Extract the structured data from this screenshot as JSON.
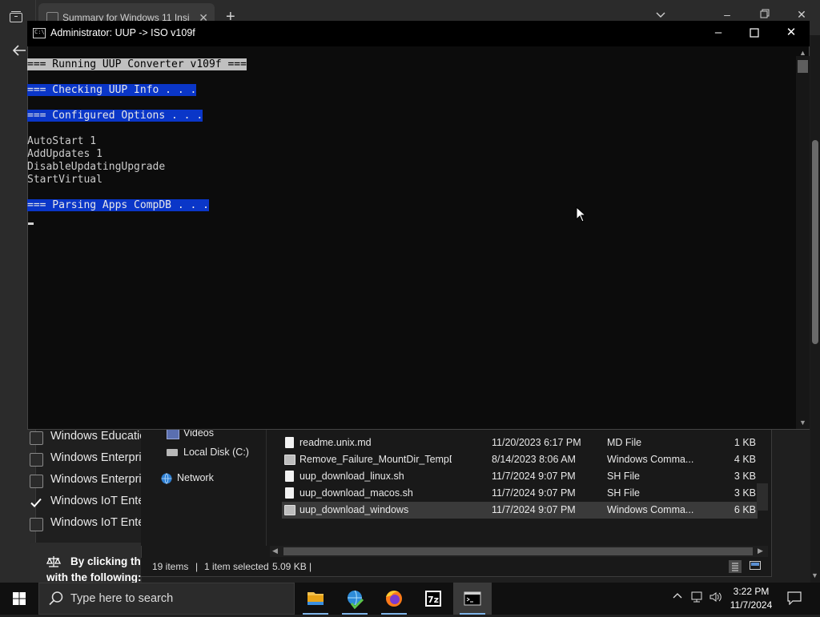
{
  "browser": {
    "tab_title": "Summary for Windows 11 Insi",
    "tab_close": "✕",
    "new_tab": "+",
    "checkbox_items": [
      {
        "label": "Windows Educatio",
        "checked": false
      },
      {
        "label": "Windows Enterpri",
        "checked": false
      },
      {
        "label": "Windows Enterpri",
        "checked": false
      },
      {
        "label": "Windows IoT Ente",
        "checked": true
      },
      {
        "label": "Windows IoT Ente",
        "checked": false
      }
    ],
    "license_line1": "By clicking th",
    "license_line2": "with the following:"
  },
  "console": {
    "title": "Administrator:  UUP -> ISO v109f",
    "lines": [
      {
        "text": "=== Running UUP Converter v109f ===",
        "style": "grey"
      },
      {
        "text": "=== Checking UUP Info . . .",
        "style": "blue"
      },
      {
        "text": "=== Configured Options . . .",
        "style": "blue"
      },
      {
        "text": "AutoStart 1",
        "style": "plain"
      },
      {
        "text": "AddUpdates 1",
        "style": "plain"
      },
      {
        "text": "DisableUpdatingUpgrade",
        "style": "plain"
      },
      {
        "text": "StartVirtual",
        "style": "plain"
      },
      {
        "text": "=== Parsing Apps CompDB . . .",
        "style": "blue"
      }
    ]
  },
  "explorer": {
    "nav": {
      "videos": "Videos",
      "local_disk": "Local Disk (C:)",
      "network": "Network"
    },
    "files": [
      {
        "name": "readme.unix.md",
        "date": "11/20/2023 6:17 PM",
        "type": "MD File",
        "size": "1 KB",
        "icon": "file-icon",
        "selected": false
      },
      {
        "name": "Remove_Failure_MountDir_TempDir",
        "date": "8/14/2023 8:06 AM",
        "type": "Windows Comma...",
        "size": "4 KB",
        "icon": "cmd-icon",
        "selected": false
      },
      {
        "name": "uup_download_linux.sh",
        "date": "11/7/2024 9:07 PM",
        "type": "SH File",
        "size": "3 KB",
        "icon": "file-icon",
        "selected": false
      },
      {
        "name": "uup_download_macos.sh",
        "date": "11/7/2024 9:07 PM",
        "type": "SH File",
        "size": "3 KB",
        "icon": "file-icon",
        "selected": false
      },
      {
        "name": "uup_download_windows",
        "date": "11/7/2024 9:07 PM",
        "type": "Windows Comma...",
        "size": "6 KB",
        "icon": "cmd-icon",
        "selected": true
      }
    ],
    "status": {
      "items": "19 items",
      "selected": "1 item selected",
      "size": "5.09 KB",
      "separator": "|"
    }
  },
  "taskbar": {
    "search_placeholder": "Type here to search",
    "apps": [
      "file-explorer",
      "internet-download-manager",
      "firefox",
      "7-zip",
      "command-prompt"
    ],
    "time": "3:22 PM",
    "date": "11/7/2024"
  },
  "colors": {
    "console_highlight_blue": "#0a36c8",
    "console_highlight_grey": "#c0c0c0",
    "taskbar_bg": "#101010"
  }
}
